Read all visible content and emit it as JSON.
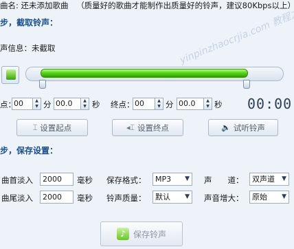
{
  "header": {
    "song_label": "曲名: 还未添加歌曲",
    "hint": "（质量好的歌曲才能制作出质量好的铃声，建议80Kbps以上）"
  },
  "step2": {
    "title": "步，截取铃声："
  },
  "info": {
    "label": "声信息：",
    "value": "未截取"
  },
  "player": {
    "play_icon": "play-icon",
    "progress_start": 0.06,
    "progress_end": 0.86
  },
  "range": {
    "start_label": "点：",
    "start_min": "00",
    "min_unit": "分",
    "start_sec": "00.0",
    "sec_unit": "秒",
    "end_label": "终点：",
    "end_min": "00",
    "end_sec": "00.0",
    "timer": "00:00"
  },
  "buttons": {
    "set_start": "设置起点",
    "set_end": "设置终点",
    "preview": "试听铃声"
  },
  "step3": {
    "title": "步，保存设置："
  },
  "settings": {
    "fade_in_label": "曲首淡入",
    "fade_in_value": "2000",
    "fade_out_label": "曲尾淡入",
    "fade_out_value": "2000",
    "ms_unit": "毫秒",
    "format_label": "保存格式：",
    "format_value": "MP3",
    "quality_label": "铃声质量：",
    "quality_value": "默认",
    "channel_label": "声　　道：",
    "channel_value": "双声道",
    "boost_label": "声音增大：",
    "boost_value": "原始"
  },
  "save": {
    "label": "保存铃声"
  },
  "watermark": {
    "text": "yinpinzhaocrjia.com 教程之家"
  }
}
